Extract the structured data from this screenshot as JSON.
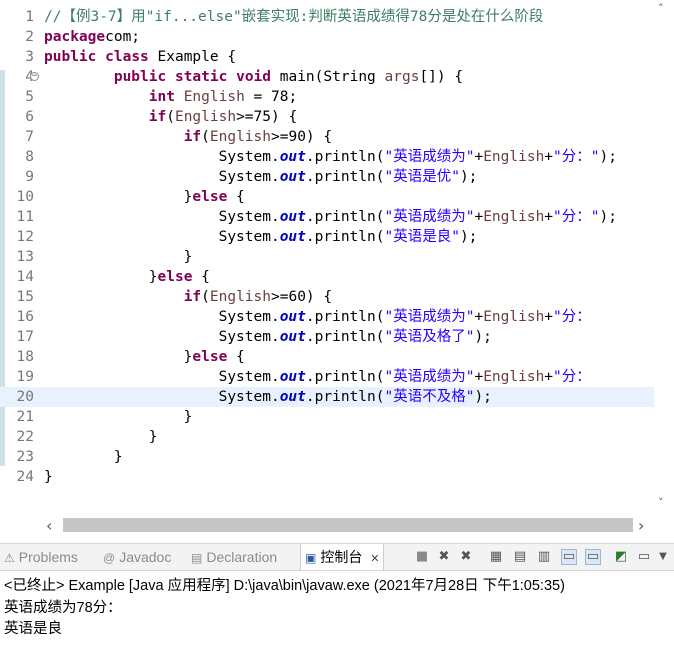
{
  "editor": {
    "lines": [
      {
        "n": "1",
        "parts": [
          [
            "cm",
            "//【例3-7】用\"if...else\"嵌套实现:判断英语成绩得78分是处在什么阶段"
          ]
        ]
      },
      {
        "n": "2",
        "parts": [
          [
            "kw",
            "package"
          ],
          [
            "",
            "com;"
          ]
        ]
      },
      {
        "n": "3",
        "parts": [
          [
            "kw",
            "public"
          ],
          [
            "",
            " "
          ],
          [
            "kw",
            "class"
          ],
          [
            "",
            " Example {"
          ]
        ]
      },
      {
        "n": "4",
        "fold": true,
        "parts": [
          [
            "",
            "        "
          ],
          [
            "kw",
            "public"
          ],
          [
            "",
            " "
          ],
          [
            "kw",
            "static"
          ],
          [
            "",
            " "
          ],
          [
            "kw",
            "void"
          ],
          [
            "",
            " main(String "
          ],
          [
            "lv",
            "args"
          ],
          [
            "",
            "[]) {"
          ]
        ]
      },
      {
        "n": "5",
        "parts": [
          [
            "",
            "            "
          ],
          [
            "kw",
            "int"
          ],
          [
            "",
            " "
          ],
          [
            "lv",
            "English"
          ],
          [
            "",
            " = 78;"
          ]
        ]
      },
      {
        "n": "6",
        "parts": [
          [
            "",
            "            "
          ],
          [
            "kw",
            "if"
          ],
          [
            "",
            "("
          ],
          [
            "lv",
            "English"
          ],
          [
            "",
            ">=75) {"
          ]
        ]
      },
      {
        "n": "7",
        "parts": [
          [
            "",
            "                "
          ],
          [
            "kw",
            "if"
          ],
          [
            "",
            "("
          ],
          [
            "lv",
            "English"
          ],
          [
            "",
            ">=90) {"
          ]
        ]
      },
      {
        "n": "8",
        "parts": [
          [
            "",
            "                    System."
          ],
          [
            "fd",
            "out"
          ],
          [
            "",
            ".println("
          ],
          [
            "st",
            "\"英语成绩为\""
          ],
          [
            "",
            "+"
          ],
          [
            "lv",
            "English"
          ],
          [
            "",
            "+"
          ],
          [
            "st",
            "\"分：\""
          ],
          [
            "",
            ");"
          ]
        ]
      },
      {
        "n": "9",
        "parts": [
          [
            "",
            "                    System."
          ],
          [
            "fd",
            "out"
          ],
          [
            "",
            ".println("
          ],
          [
            "st",
            "\"英语是优\""
          ],
          [
            "",
            ");"
          ]
        ]
      },
      {
        "n": "10",
        "parts": [
          [
            "",
            "                }"
          ],
          [
            "kw",
            "else"
          ],
          [
            "",
            " {"
          ]
        ]
      },
      {
        "n": "11",
        "parts": [
          [
            "",
            "                    System."
          ],
          [
            "fd",
            "out"
          ],
          [
            "",
            ".println("
          ],
          [
            "st",
            "\"英语成绩为\""
          ],
          [
            "",
            "+"
          ],
          [
            "lv",
            "English"
          ],
          [
            "",
            "+"
          ],
          [
            "st",
            "\"分：\""
          ],
          [
            "",
            ");"
          ]
        ]
      },
      {
        "n": "12",
        "parts": [
          [
            "",
            "                    System."
          ],
          [
            "fd",
            "out"
          ],
          [
            "",
            ".println("
          ],
          [
            "st",
            "\"英语是良\""
          ],
          [
            "",
            ");"
          ]
        ]
      },
      {
        "n": "13",
        "parts": [
          [
            "",
            "                }"
          ]
        ]
      },
      {
        "n": "14",
        "parts": [
          [
            "",
            "            }"
          ],
          [
            "kw",
            "else"
          ],
          [
            "",
            " {"
          ]
        ]
      },
      {
        "n": "15",
        "parts": [
          [
            "",
            "                "
          ],
          [
            "kw",
            "if"
          ],
          [
            "",
            "("
          ],
          [
            "lv",
            "English"
          ],
          [
            "",
            ">=60) {"
          ]
        ]
      },
      {
        "n": "16",
        "parts": [
          [
            "",
            "                    System."
          ],
          [
            "fd",
            "out"
          ],
          [
            "",
            ".println("
          ],
          [
            "st",
            "\"英语成绩为\""
          ],
          [
            "",
            "+"
          ],
          [
            "lv",
            "English"
          ],
          [
            "",
            "+"
          ],
          [
            "st",
            "\"分："
          ]
        ]
      },
      {
        "n": "17",
        "parts": [
          [
            "",
            "                    System."
          ],
          [
            "fd",
            "out"
          ],
          [
            "",
            ".println("
          ],
          [
            "st",
            "\"英语及格了\""
          ],
          [
            "",
            ");"
          ]
        ]
      },
      {
        "n": "18",
        "parts": [
          [
            "",
            "                }"
          ],
          [
            "kw",
            "else"
          ],
          [
            "",
            " {"
          ]
        ]
      },
      {
        "n": "19",
        "parts": [
          [
            "",
            "                    System."
          ],
          [
            "fd",
            "out"
          ],
          [
            "",
            ".println("
          ],
          [
            "st",
            "\"英语成绩为\""
          ],
          [
            "",
            "+"
          ],
          [
            "lv",
            "English"
          ],
          [
            "",
            "+"
          ],
          [
            "st",
            "\"分："
          ]
        ]
      },
      {
        "n": "20",
        "current": true,
        "parts": [
          [
            "",
            "                    System."
          ],
          [
            "fd",
            "out"
          ],
          [
            "",
            ".println("
          ],
          [
            "st",
            "\"英语不及格\""
          ],
          [
            "",
            ");"
          ]
        ]
      },
      {
        "n": "21",
        "parts": [
          [
            "",
            "                }"
          ]
        ]
      },
      {
        "n": "22",
        "parts": [
          [
            "",
            "            }"
          ]
        ]
      },
      {
        "n": "23",
        "parts": [
          [
            "",
            "        }"
          ]
        ]
      },
      {
        "n": "24",
        "parts": [
          [
            "",
            "}"
          ]
        ]
      }
    ]
  },
  "scroll": {
    "up": "˄",
    "down": "˅",
    "left": "‹",
    "right": "›"
  },
  "console_tabs": {
    "problems": "Problems",
    "javadoc": "Javadoc",
    "declaration": "Declaration",
    "console": "控制台",
    "console_close": "✕"
  },
  "console_icons": [
    "terminate-icon",
    "remove-launch-icon",
    "remove-all-icon",
    "scroll-lock-icon",
    "pin-icon",
    "word-wrap-icon",
    "show-on-stdout-icon",
    "show-on-stderr-icon",
    "open-console-icon",
    "display-console-icon"
  ],
  "console": {
    "header": "<已终止> Example [Java 应用程序] D:\\java\\bin\\javaw.exe  (2021年7月28日 下午1:05:35)",
    "output": [
      "英语成绩为78分：",
      "英语是良"
    ]
  },
  "colors": {
    "keyword": "#7f0055",
    "comment": "#3f7f5f",
    "string": "#2a00ff",
    "static_field": "#0000c0",
    "local_var": "#6a3e3e",
    "current_line": "#e8f2fe"
  }
}
